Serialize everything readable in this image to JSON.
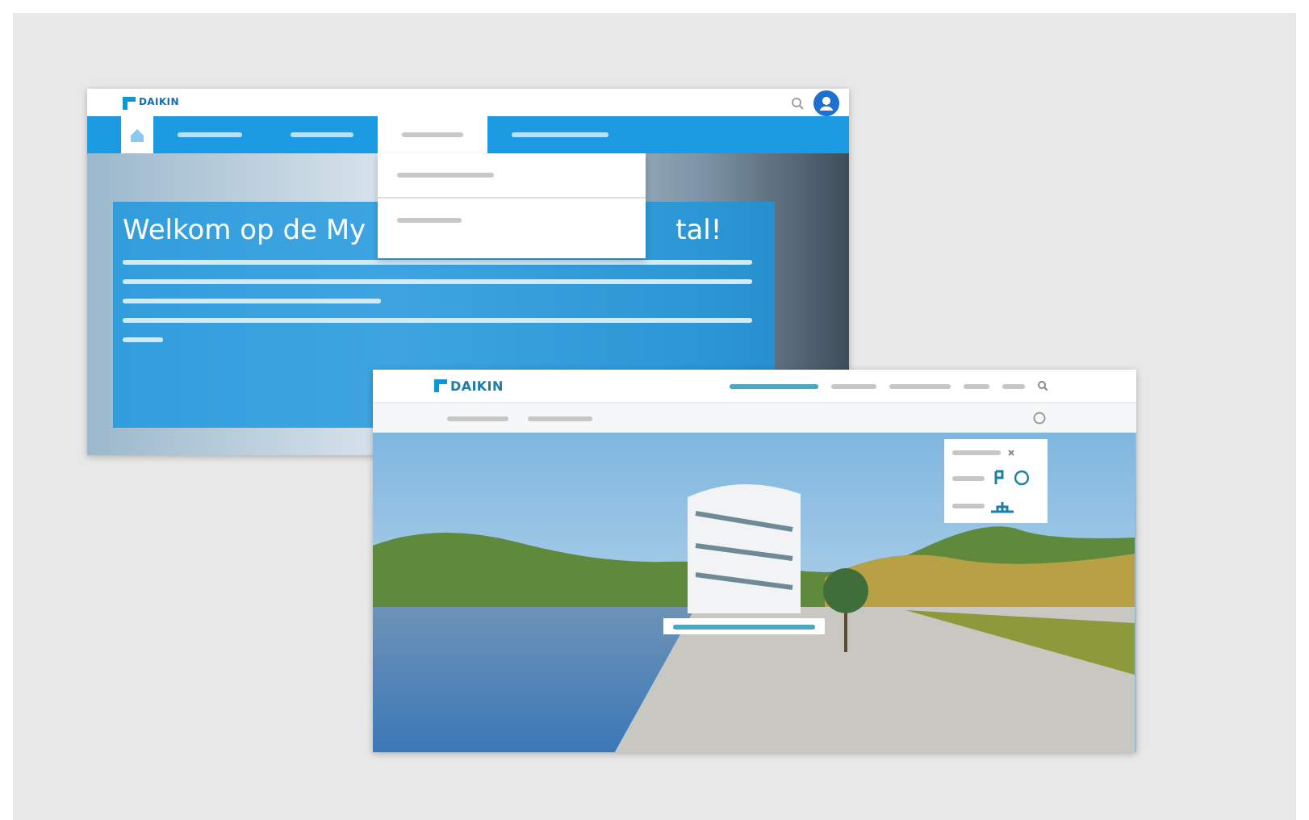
{
  "screenshots": [
    {
      "kind": "portal",
      "logo": "DAIKIN",
      "nav_tabs": [
        {
          "selected": false
        },
        {
          "selected": false
        },
        {
          "selected": true
        },
        {
          "selected": false
        }
      ],
      "heading_visible_start": "Welkom op de My",
      "heading_visible_end": "tal!"
    },
    {
      "kind": "tour",
      "logo": "DAIKIN"
    }
  ]
}
